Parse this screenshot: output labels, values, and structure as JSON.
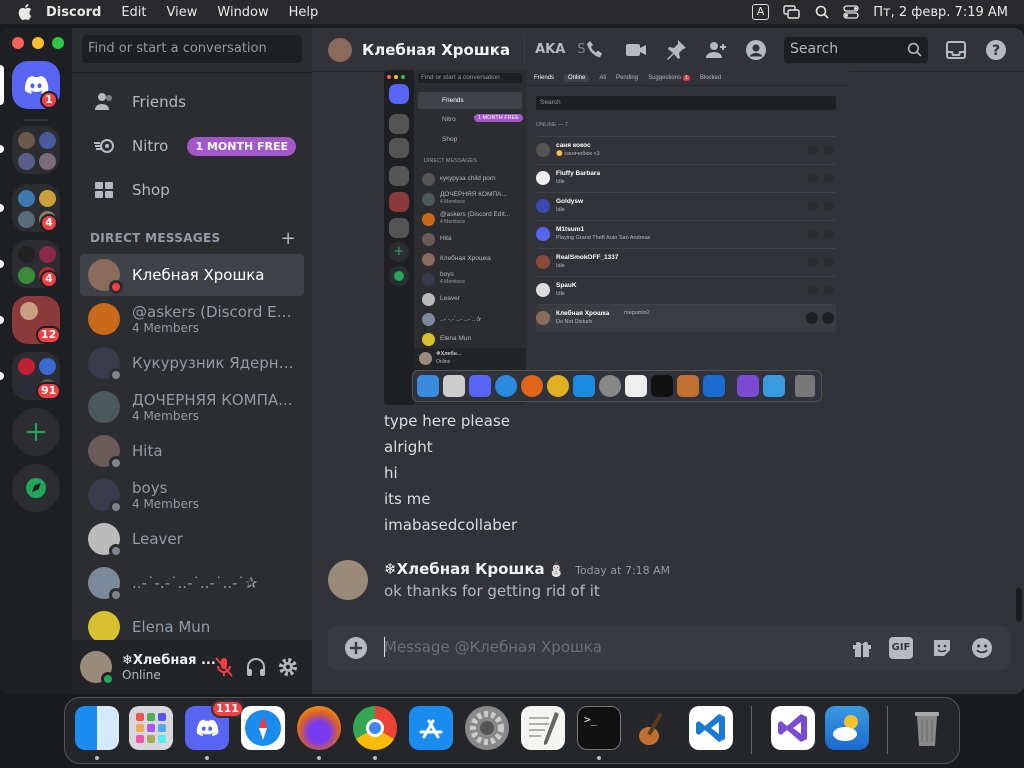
{
  "menubar": {
    "app_name": "Discord",
    "items": [
      "Edit",
      "View",
      "Window",
      "Help"
    ],
    "input_indicator": "A",
    "datetime": "Пт, 2 февр.  7:19 AM"
  },
  "guilds": {
    "home_badge": "1",
    "folder_badges": [
      "4",
      "4",
      "12",
      "91"
    ]
  },
  "sidebar": {
    "search_placeholder": "Find or start a conversation",
    "nav": {
      "friends": "Friends",
      "nitro": "Nitro",
      "nitro_badge": "1 MONTH FREE",
      "shop": "Shop"
    },
    "dm_header": "DIRECT MESSAGES",
    "dm_add": "+",
    "dms": [
      {
        "name": "Клебная Хрошка",
        "sub": ""
      },
      {
        "name": "@askers (Discord Edit...",
        "sub": "4 Members"
      },
      {
        "name": "Кукурузник Ядерный",
        "sub": ""
      },
      {
        "name": "ДОЧЕРНЯЯ КОМПА...",
        "sub": "4 Members"
      },
      {
        "name": "Hita",
        "sub": ""
      },
      {
        "name": "boys",
        "sub": "4 Members"
      },
      {
        "name": "Leaver",
        "sub": ""
      },
      {
        "name": "..-˙-.-˙..-˙..-˙..-˙✰",
        "sub": ""
      },
      {
        "name": "Elena Mun",
        "sub": ""
      }
    ],
    "user": {
      "name": "❄Хлебная ...",
      "status": "Online"
    }
  },
  "header": {
    "title": "Клебная Хрошка",
    "aka": "AKA",
    "aka_trailing": "S",
    "search_placeholder": "Search"
  },
  "screenshot": {
    "search": "Find or start a conversation",
    "tabs": [
      "Friends",
      "Online",
      "All",
      "Pending",
      "Suggestions",
      "Blocked"
    ],
    "suggestions_badge": "1",
    "nav": [
      "Friends",
      "Nitro",
      "Shop"
    ],
    "nitro_badge": "1 MONTH FREE",
    "dm_header": "DIRECT MESSAGES",
    "dms": [
      {
        "name": "кукуруза child porn",
        "sub": ""
      },
      {
        "name": "ДОЧЕРНЯЯ КОМПА...",
        "sub": "4 Members"
      },
      {
        "name": "@askers (Discord Edit...",
        "sub": "4 Members"
      },
      {
        "name": "Hita",
        "sub": ""
      },
      {
        "name": "Клебная Хрошка",
        "sub": ""
      },
      {
        "name": "boys",
        "sub": "4 Members"
      },
      {
        "name": "Leaver",
        "sub": ""
      },
      {
        "name": "..-˙-.-˙..-˙..-˙..✰",
        "sub": ""
      },
      {
        "name": "Elena Mun",
        "sub": ""
      }
    ],
    "user": {
      "name": "❄Хлебн...",
      "status": "Online"
    },
    "list_search": "Search",
    "online_label": "ONLINE — 7",
    "friends": [
      {
        "name": "саня кокос",
        "status": "♊ саничобюк <3"
      },
      {
        "name": "Fluffy Barbara",
        "status": "Idle"
      },
      {
        "name": "Goldysw",
        "status": "Idle"
      },
      {
        "name": "M1tsum1",
        "status": "Playing Grand Theft Auto San Andreas"
      },
      {
        "name": "RealSmokOFF_1337",
        "status": "Idle"
      },
      {
        "name": "SpauK",
        "status": "Idle"
      },
      {
        "name": "Клебная Хрошка",
        "tag": "megumin2",
        "status": "Do Not Disturb"
      }
    ]
  },
  "messages": {
    "lines": [
      "type here please",
      "alright",
      "hi",
      "its me",
      "imabasedcollaber"
    ],
    "author": "❄Хлебная Крошка",
    "author_emoji": "⛄",
    "timestamp": "Today at 7:18 AM",
    "text": "ok thanks for getting rid of it"
  },
  "composer": {
    "placeholder": "Message @Клебная Хрошка",
    "gif_label": "GIF"
  },
  "dock": {
    "discord_badge": "111"
  },
  "colors": {
    "blurple": "#5865f2",
    "red": "#f23f43",
    "green": "#23a55a",
    "nitro": "#a357c8"
  }
}
